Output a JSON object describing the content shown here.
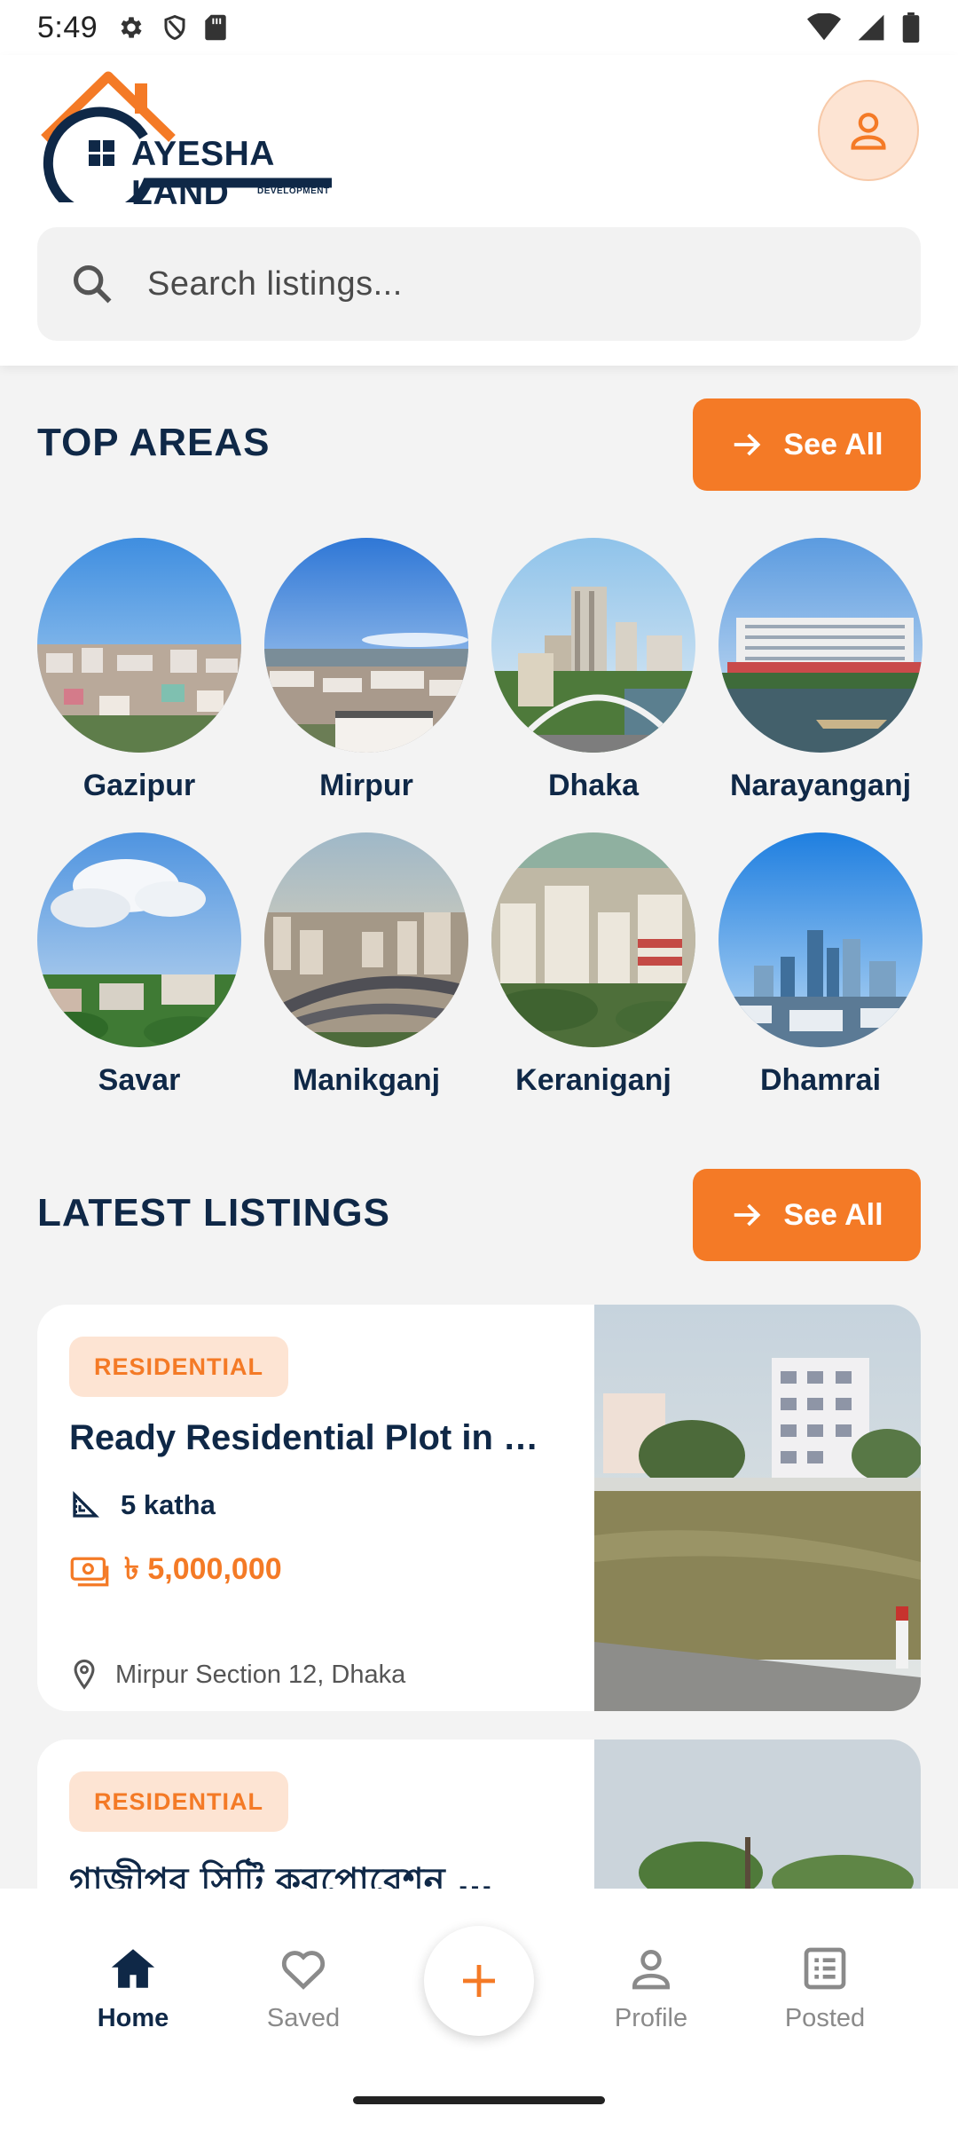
{
  "status_bar": {
    "time": "5:49"
  },
  "header": {
    "logo": {
      "name": "AYESHA LAND",
      "tagline": "DEVELOPMENT"
    },
    "search": {
      "placeholder": "Search listings..."
    }
  },
  "top_areas": {
    "title": "TOP AREAS",
    "see_all": "See All",
    "items": [
      {
        "label": "Gazipur"
      },
      {
        "label": "Mirpur"
      },
      {
        "label": "Dhaka"
      },
      {
        "label": "Narayanganj"
      },
      {
        "label": "Savar"
      },
      {
        "label": "Manikganj"
      },
      {
        "label": "Keraniganj"
      },
      {
        "label": "Dhamrai"
      }
    ]
  },
  "latest_listings": {
    "title": "LATEST LISTINGS",
    "see_all": "See All",
    "items": [
      {
        "badge": "RESIDENTIAL",
        "title": "Ready Residential Plot in …",
        "size": "5 katha",
        "price": "৳ 5,000,000",
        "location": "Mirpur Section 12, Dhaka"
      },
      {
        "badge": "RESIDENTIAL",
        "title": "গাজীপুর সিটি করপোরেশন …"
      }
    ]
  },
  "bottom_nav": {
    "items": [
      {
        "label": "Home",
        "icon": "home-icon",
        "active": true
      },
      {
        "label": "Saved",
        "icon": "heart-icon",
        "active": false
      },
      {
        "label": "Profile",
        "icon": "person-icon",
        "active": false
      },
      {
        "label": "Posted",
        "icon": "list-icon",
        "active": false
      }
    ],
    "fab_icon": "plus-icon"
  },
  "colors": {
    "accent": "#f47a26",
    "navy": "#0f2847",
    "badge_bg": "#fde4d3"
  }
}
